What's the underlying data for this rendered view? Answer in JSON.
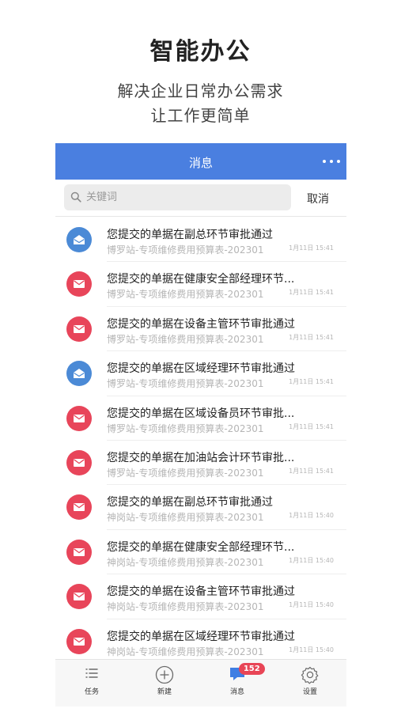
{
  "promo": {
    "title": "智能办公",
    "subtitle_line1": "解决企业日常办公需求",
    "subtitle_line2": "让工作更简单"
  },
  "navbar": {
    "title": "消息",
    "more_icon": "more-dots-icon"
  },
  "search": {
    "placeholder": "关键词",
    "value": "",
    "cancel_label": "取消"
  },
  "colors": {
    "navbar": "#4a7fe0",
    "unread_avatar": "#e8455a",
    "read_avatar": "#4b8ad6",
    "badge": "#e84556"
  },
  "messages": [
    {
      "title": "您提交的单据在副总环节审批通过",
      "subtitle": "博罗站-专项维修费用预算表-202301",
      "time": "1月11日 15:41",
      "status": "read",
      "icon": "envelope-open-icon"
    },
    {
      "title": "您提交的单据在健康安全部经理环节...",
      "subtitle": "博罗站-专项维修费用预算表-202301",
      "time": "1月11日 15:41",
      "status": "unread",
      "icon": "envelope-icon"
    },
    {
      "title": "您提交的单据在设备主管环节审批通过",
      "subtitle": "博罗站-专项维修费用预算表-202301",
      "time": "1月11日 15:41",
      "status": "unread",
      "icon": "envelope-icon"
    },
    {
      "title": "您提交的单据在区域经理环节审批通过",
      "subtitle": "博罗站-专项维修费用预算表-202301",
      "time": "1月11日 15:41",
      "status": "read",
      "icon": "envelope-open-icon"
    },
    {
      "title": "您提交的单据在区域设备员环节审批...",
      "subtitle": "博罗站-专项维修费用预算表-202301",
      "time": "1月11日 15:41",
      "status": "unread",
      "icon": "envelope-icon"
    },
    {
      "title": "您提交的单据在加油站会计环节审批...",
      "subtitle": "博罗站-专项维修费用预算表-202301",
      "time": "1月11日 15:41",
      "status": "unread",
      "icon": "envelope-icon"
    },
    {
      "title": "您提交的单据在副总环节审批通过",
      "subtitle": "神岗站-专项维修费用预算表-202301",
      "time": "1月11日 15:40",
      "status": "unread",
      "icon": "envelope-icon"
    },
    {
      "title": "您提交的单据在健康安全部经理环节...",
      "subtitle": "神岗站-专项维修费用预算表-202301",
      "time": "1月11日 15:40",
      "status": "unread",
      "icon": "envelope-icon"
    },
    {
      "title": "您提交的单据在设备主管环节审批通过",
      "subtitle": "神岗站-专项维修费用预算表-202301",
      "time": "1月11日 15:40",
      "status": "unread",
      "icon": "envelope-icon"
    },
    {
      "title": "您提交的单据在区域经理环节审批通过",
      "subtitle": "神岗站-专项维修费用预算表-202301",
      "time": "1月11日 15:40",
      "status": "unread",
      "icon": "envelope-icon"
    }
  ],
  "tabbar": {
    "tabs": [
      {
        "label": "任务",
        "icon": "task-list-icon"
      },
      {
        "label": "新建",
        "icon": "add-circle-icon"
      },
      {
        "label": "消息",
        "icon": "chat-bubble-icon",
        "badge": "152"
      },
      {
        "label": "设置",
        "icon": "gear-icon"
      }
    ]
  }
}
